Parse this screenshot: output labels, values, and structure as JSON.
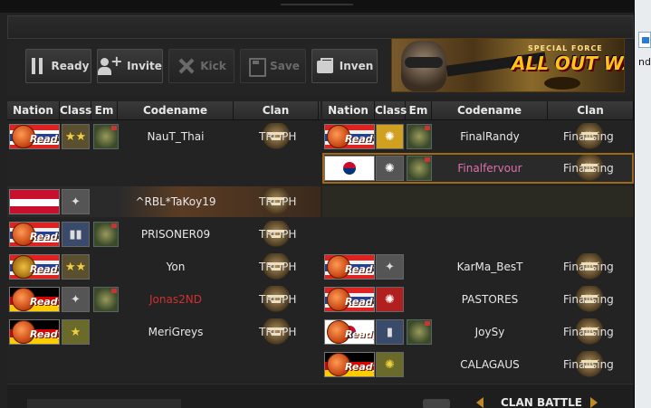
{
  "toolbar": {
    "ready": "Ready",
    "invite": "Invite",
    "kick": "Kick",
    "save": "Save",
    "inven": "Inven"
  },
  "banner": {
    "tagline": "SPECIAL FORCE",
    "title": "ALL OUT WAR"
  },
  "headers": {
    "nation": "Nation",
    "class": "Class",
    "em": "Em",
    "codename": "Codename",
    "clan": "Clan"
  },
  "ready_badge": "Ready",
  "team_left": [
    {
      "codename": "NauT_Thai",
      "clan": "TROPH",
      "name_color": "#e8e8e8"
    },
    {
      "codename": "",
      "clan": ""
    },
    {
      "codename": "^RBL*TaKoy19",
      "clan": "TROPH",
      "name_color": "#e8e8e8"
    },
    {
      "codename": "PRISONER09",
      "clan": "TROPH",
      "name_color": "#e8e8e8"
    },
    {
      "codename": "Yon",
      "clan": "TROPH",
      "name_color": "#e8e8e8"
    },
    {
      "codename": "Jonas2ND",
      "clan": "TROPH",
      "name_color": "#d03030"
    },
    {
      "codename": "MeriGreys",
      "clan": "TROPH",
      "name_color": "#e8e8e8"
    }
  ],
  "team_right": [
    {
      "codename": "FinalRandy",
      "clan": "Finalising",
      "name_color": "#e8e8e8"
    },
    {
      "codename": "Finalfervour",
      "clan": "Finalising",
      "name_color": "#e070b0"
    },
    {
      "codename": "",
      "clan": ""
    },
    {
      "codename": "",
      "clan": ""
    },
    {
      "codename": "KarMa_BesT",
      "clan": "Finalising",
      "name_color": "#e8e8e8"
    },
    {
      "codename": "PASTORES",
      "clan": "Finalising",
      "name_color": "#e8e8e8"
    },
    {
      "codename": "JoySy",
      "clan": "Finalising",
      "name_color": "#e8e8e8"
    },
    {
      "codename": "CALAGAUS",
      "clan": "Finalising",
      "name_color": "#e8e8e8"
    }
  ],
  "footer": {
    "mode": "CLAN BATTLE"
  },
  "desktop": {
    "label": "nd"
  }
}
